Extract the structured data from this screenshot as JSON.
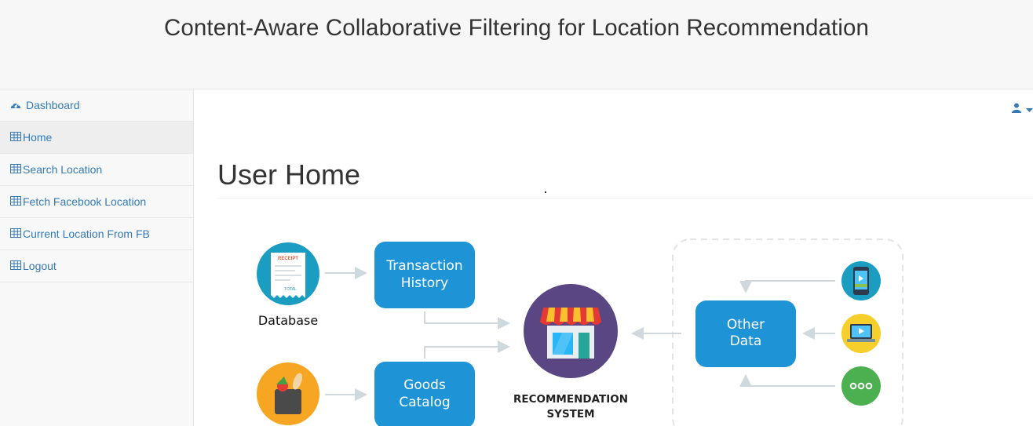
{
  "header": {
    "title": "Content-Aware Collaborative Filtering for Location Recommendation"
  },
  "sidebar": {
    "items": [
      {
        "label": "Dashboard",
        "icon": "dashboard-icon",
        "active": false
      },
      {
        "label": "Home",
        "icon": "table-icon",
        "active": true
      },
      {
        "label": "Search Location",
        "icon": "table-icon",
        "active": false
      },
      {
        "label": "Fetch Facebook Location",
        "icon": "table-icon",
        "active": false
      },
      {
        "label": "Current Location From FB",
        "icon": "table-icon",
        "active": false
      },
      {
        "label": "Logout",
        "icon": "table-icon",
        "active": false
      }
    ]
  },
  "main": {
    "page_title": "User Home",
    "user_menu": {
      "icon": "user-icon",
      "caret": "caret-down-icon"
    }
  },
  "diagram": {
    "database_label": "Database",
    "receipt_header": "RECEIPT",
    "receipt_footer": "TOTAL",
    "transaction_line1": "Transaction",
    "transaction_line2": "History",
    "goods_line1": "Goods",
    "goods_line2": "Catalog",
    "rec_line1": "RECOMMENDATION",
    "rec_line2": "SYSTEM",
    "other_line1": "Other",
    "other_line2": "Data",
    "colors": {
      "blue_box": "#1e94d6",
      "teal_circle": "#1b9dc2",
      "orange_circle": "#f6a623",
      "purple_circle": "#5a4683",
      "yellow_circle": "#f7cf2c",
      "green_circle": "#4caf50",
      "arrow": "#cfd8dc"
    }
  }
}
